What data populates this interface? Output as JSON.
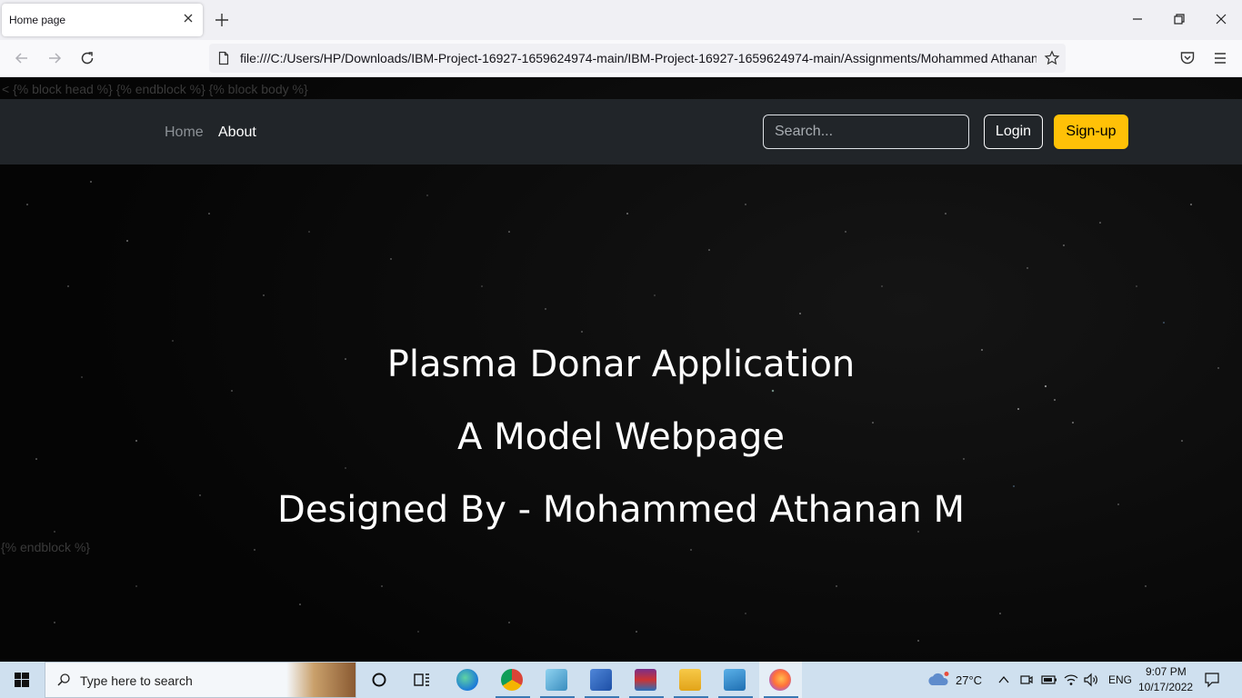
{
  "browser": {
    "tab_title": "Home page",
    "url": "file:///C:/Users/HP/Downloads/IBM-Project-16927-1659624974-main/IBM-Project-16927-1659624974-main/Assignments/Mohammed Athanan M"
  },
  "page": {
    "template_top": "< {% block head %} {% endblock %} {% block body %}",
    "template_bottom": "{% endblock %}",
    "nav": {
      "home": "Home",
      "about": "About",
      "search_placeholder": "Search...",
      "login": "Login",
      "signup": "Sign-up"
    },
    "hero": {
      "line1": "Plasma Donar Application",
      "line2": "A Model Webpage",
      "line3": "Designed By - Mohammed Athanan M"
    }
  },
  "taskbar": {
    "search_placeholder": "Type here to search",
    "weather": "27°C",
    "language": "ENG",
    "time": "9:07 PM",
    "date": "10/17/2022"
  }
}
